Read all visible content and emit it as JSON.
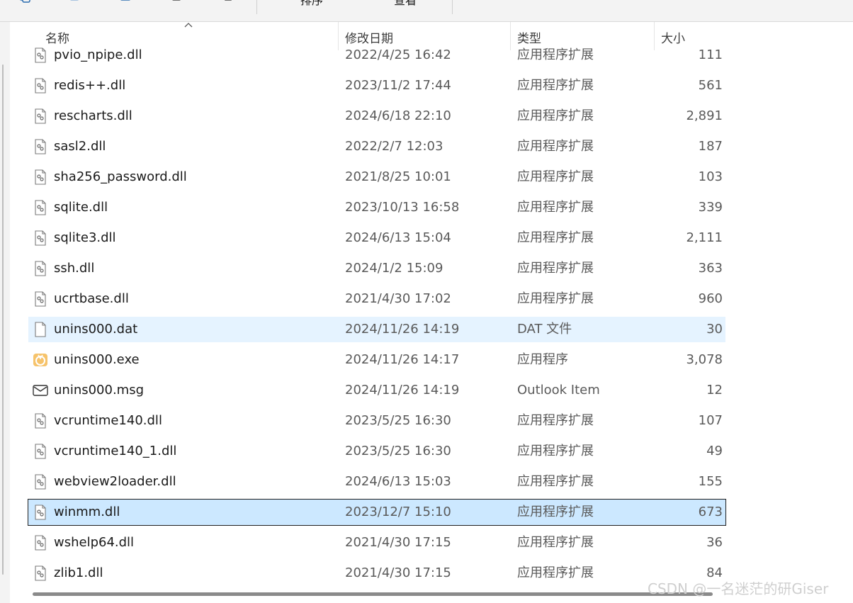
{
  "toolbar": {
    "sort_label": "排序",
    "view_label": "查看"
  },
  "columns": {
    "name": "名称",
    "date": "修改日期",
    "type": "类型",
    "size": "大小"
  },
  "files": [
    {
      "name": "pvio_npipe.dll",
      "date": "2022/4/25 16:42",
      "type": "应用程序扩展",
      "size": "111",
      "icon": "dll-file-icon"
    },
    {
      "name": "redis++.dll",
      "date": "2023/11/2 17:44",
      "type": "应用程序扩展",
      "size": "561",
      "icon": "dll-file-icon"
    },
    {
      "name": "rescharts.dll",
      "date": "2024/6/18 22:10",
      "type": "应用程序扩展",
      "size": "2,891",
      "icon": "dll-file-icon"
    },
    {
      "name": "sasl2.dll",
      "date": "2022/2/7 12:03",
      "type": "应用程序扩展",
      "size": "187",
      "icon": "dll-file-icon"
    },
    {
      "name": "sha256_password.dll",
      "date": "2021/8/25 10:01",
      "type": "应用程序扩展",
      "size": "103",
      "icon": "dll-file-icon"
    },
    {
      "name": "sqlite.dll",
      "date": "2023/10/13 16:58",
      "type": "应用程序扩展",
      "size": "339",
      "icon": "dll-file-icon"
    },
    {
      "name": "sqlite3.dll",
      "date": "2024/6/13 15:04",
      "type": "应用程序扩展",
      "size": "2,111",
      "icon": "dll-file-icon"
    },
    {
      "name": "ssh.dll",
      "date": "2024/1/2 15:09",
      "type": "应用程序扩展",
      "size": "363",
      "icon": "dll-file-icon"
    },
    {
      "name": "ucrtbase.dll",
      "date": "2021/4/30 17:02",
      "type": "应用程序扩展",
      "size": "960",
      "icon": "dll-file-icon"
    },
    {
      "name": "unins000.dat",
      "date": "2024/11/26 14:19",
      "type": "DAT 文件",
      "size": "30",
      "icon": "blank-file-icon",
      "state": "hover"
    },
    {
      "name": "unins000.exe",
      "date": "2024/11/26 14:17",
      "type": "应用程序",
      "size": "3,078",
      "icon": "installer-app-icon"
    },
    {
      "name": "unins000.msg",
      "date": "2024/11/26 14:19",
      "type": "Outlook Item",
      "size": "12",
      "icon": "mail-envelope-icon"
    },
    {
      "name": "vcruntime140.dll",
      "date": "2023/5/25 16:30",
      "type": "应用程序扩展",
      "size": "107",
      "icon": "dll-file-icon"
    },
    {
      "name": "vcruntime140_1.dll",
      "date": "2023/5/25 16:30",
      "type": "应用程序扩展",
      "size": "49",
      "icon": "dll-file-icon"
    },
    {
      "name": "webview2loader.dll",
      "date": "2024/6/13 15:03",
      "type": "应用程序扩展",
      "size": "155",
      "icon": "dll-file-icon"
    },
    {
      "name": "winmm.dll",
      "date": "2023/12/7 15:10",
      "type": "应用程序扩展",
      "size": "673",
      "icon": "dll-file-icon",
      "state": "selected"
    },
    {
      "name": "wshelp64.dll",
      "date": "2021/4/30 17:15",
      "type": "应用程序扩展",
      "size": "36",
      "icon": "dll-file-icon"
    },
    {
      "name": "zlib1.dll",
      "date": "2021/4/30 17:15",
      "type": "应用程序扩展",
      "size": "84",
      "icon": "dll-file-icon"
    }
  ],
  "watermark": "CSDN @一名迷茫的研Giser",
  "colors": {
    "hover": "#e5f3ff",
    "selected": "#cce8ff",
    "scrollbar": "#8a8a8a"
  }
}
